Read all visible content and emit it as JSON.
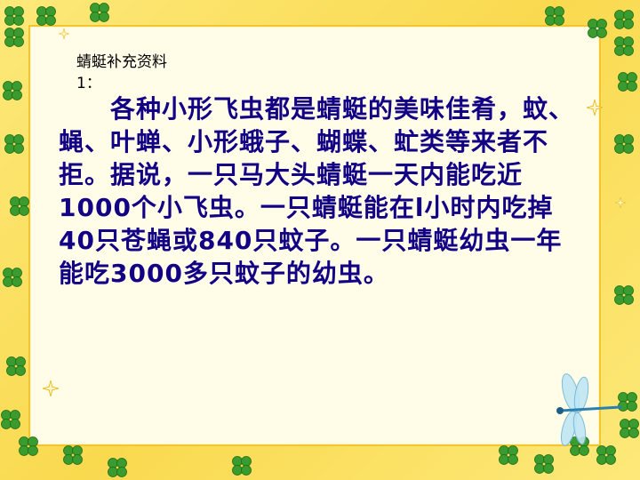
{
  "title": {
    "line1": "蜻蜓补充资料",
    "line2": "1："
  },
  "body": {
    "paragraph": "　　各种小形飞虫都是蜻蜓的美味佳肴，蚊、蝇、叶蝉、小形蛾子、蝴蝶、虻类等来者不拒。据说，一只马大头蜻蜓一天内能吃近1000个小飞虫。一只蜻蜓能在l小时内吃掉40只苍蝇或840只蚊子。一只蜻蜓幼虫一年能吃3000多只蚊子的幼虫。"
  },
  "colors": {
    "frame": "#fbe26a",
    "card": "#fffce8",
    "text": "#120085",
    "clover": "#3a9c2e"
  },
  "icons": [
    "clover-icon",
    "sparkle-icon",
    "dragonfly-icon"
  ]
}
